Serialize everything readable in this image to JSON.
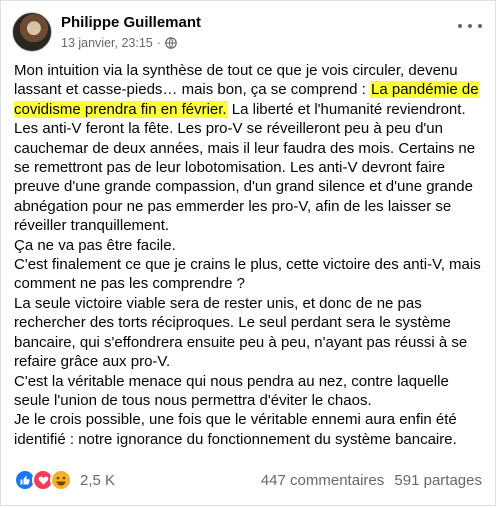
{
  "post": {
    "author": "Philippe Guillemant",
    "date": "13 janvier, 23:15",
    "date_separator": "·",
    "privacy_icon": "globe-icon",
    "more_icon": "more-options-icon",
    "highlight_color": "#ffff3a",
    "body": {
      "intro": "Mon intuition via la synthèse de tout ce que je vois circuler, devenu lassant et casse-pieds… mais bon, ça se comprend :",
      "highlight": "La pandémie de covidisme prendra fin en février.",
      "after_highlight": " La liberté et l'humanité reviendront. Les anti-V feront la fête. Les pro-V se réveilleront peu à peu d'un cauchemar de deux années, mais il leur faudra des mois. Certains ne se remettront pas de leur lobotomisation. Les anti-V devront faire preuve d'une grande compassion, d'un grand silence et d'une grande abnégation pour ne pas emmerder les pro-V, afin de les laisser se réveiller tranquillement.",
      "line_ca": "Ça ne va pas être facile.",
      "line_crains": "C'est finalement ce que je crains le plus, cette victoire des anti-V, mais comment ne pas les comprendre ?",
      "line_victoire": "La seule victoire viable sera de rester unis, et donc de ne pas rechercher des torts réciproques. Le seul perdant sera le système bancaire, qui s'effondrera ensuite peu à peu, n'ayant pas réussi à se refaire grâce aux pro-V.",
      "line_menace": "C'est la véritable menace qui nous pendra au nez, contre laquelle seule l'union de tous nous permettra d'éviter le chaos.",
      "line_possible": "Je le crois possible, une fois que le véritable ennemi aura enfin été identifié : notre ignorance du fonctionnement du système bancaire."
    }
  },
  "footer": {
    "reaction_icons": [
      "like-icon",
      "love-icon",
      "haha-icon"
    ],
    "reaction_count": "2,5 K",
    "comments": "447 commentaires",
    "shares": "591 partages"
  }
}
